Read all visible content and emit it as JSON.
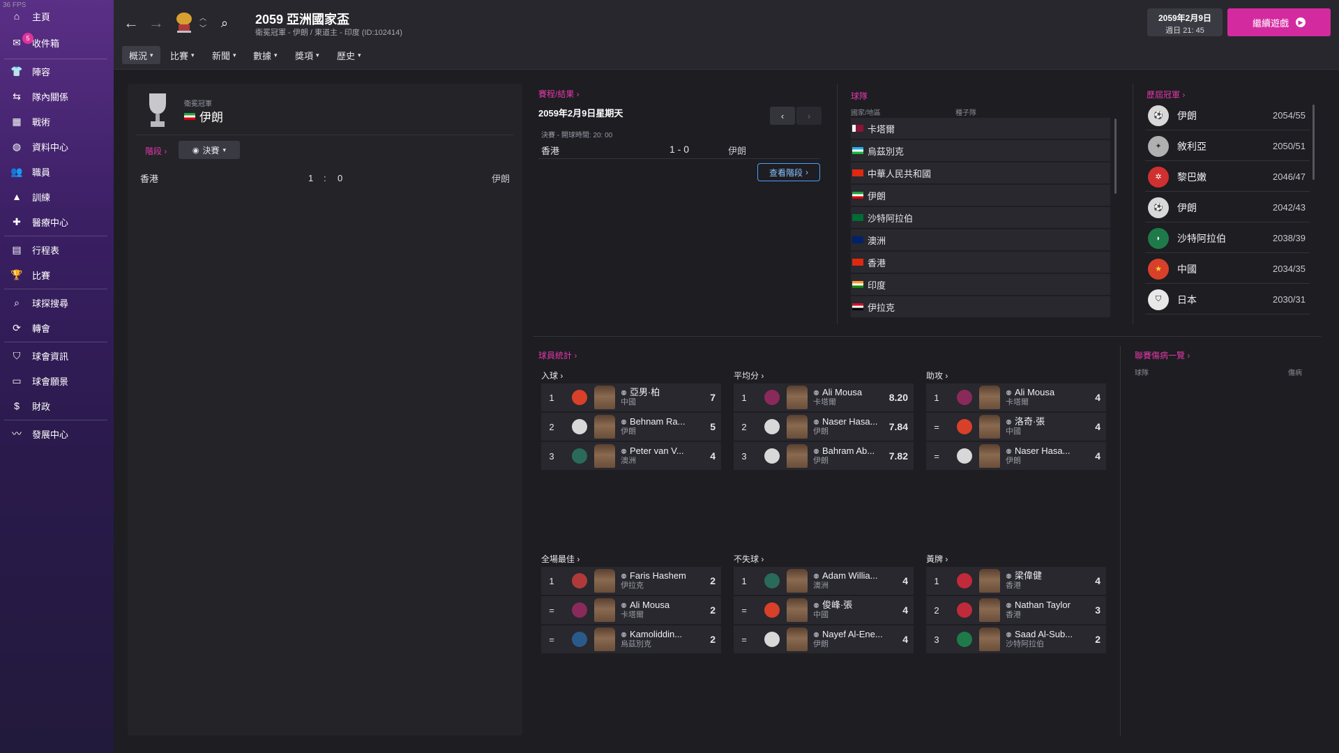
{
  "fps": "36 FPS",
  "sidebar": {
    "items": [
      {
        "label": "主頁",
        "icon": "home-icon"
      },
      {
        "label": "收件箱",
        "icon": "inbox-icon",
        "badge": "5"
      },
      {
        "label": "陣容",
        "icon": "squad-shirt-icon"
      },
      {
        "label": "隊內關係",
        "icon": "dynamics-icon"
      },
      {
        "label": "戰術",
        "icon": "tactics-icon"
      },
      {
        "label": "資料中心",
        "icon": "data-hub-icon"
      },
      {
        "label": "職員",
        "icon": "staff-icon"
      },
      {
        "label": "訓練",
        "icon": "training-icon"
      },
      {
        "label": "醫療中心",
        "icon": "medical-icon"
      },
      {
        "label": "行程表",
        "icon": "calendar-icon"
      },
      {
        "label": "比賽",
        "icon": "trophy-icon"
      },
      {
        "label": "球探搜尋",
        "icon": "search-icon"
      },
      {
        "label": "轉會",
        "icon": "transfer-icon"
      },
      {
        "label": "球會資訊",
        "icon": "club-info-icon"
      },
      {
        "label": "球會願景",
        "icon": "club-vision-icon"
      },
      {
        "label": "財政",
        "icon": "finances-icon"
      },
      {
        "label": "發展中心",
        "icon": "development-icon"
      }
    ]
  },
  "header": {
    "title": "2059 亞洲國家盃",
    "subtitle": "衛冕冠軍 - 伊朗 / 東道主 - 印度 (ID:102414)",
    "date_line1": "2059年2月9日",
    "date_line2": "週日 21: 45",
    "continue_label": "繼續遊戲"
  },
  "menu": [
    "概況",
    "比賽",
    "新聞",
    "數據",
    "獎項",
    "歷史"
  ],
  "left_panel": {
    "defending_label": "衛冕冠軍",
    "defending_team": "伊朗",
    "stage_link": "階段",
    "stage_select": "決賽",
    "match": {
      "home": "香港",
      "home_score": "1",
      "sep": ":",
      "away_score": "0",
      "away": "伊朗"
    }
  },
  "fixtures": {
    "link": "賽程/結果",
    "date": "2059年2月9日星期天",
    "info": "決賽 - 開球時間: 20: 00",
    "home": "香港",
    "score": "1 - 0",
    "away": "伊朗",
    "view_stage": "查看階段"
  },
  "teams": {
    "link": "球隊",
    "col1": "國家/地區",
    "col2": "種子隊",
    "list": [
      {
        "name": "卡塔爾",
        "flag": "qatar-flag"
      },
      {
        "name": "烏茲別克",
        "flag": "uzbekistan-flag"
      },
      {
        "name": "中華人民共和國",
        "flag": "china-flag"
      },
      {
        "name": "伊朗",
        "flag": "iran-flag"
      },
      {
        "name": "沙特阿拉伯",
        "flag": "saudi-flag"
      },
      {
        "name": "澳洲",
        "flag": "australia-flag"
      },
      {
        "name": "香港",
        "flag": "hongkong-flag"
      },
      {
        "name": "印度",
        "flag": "india-flag"
      },
      {
        "name": "伊拉克",
        "flag": "iraq-flag"
      }
    ]
  },
  "champions": {
    "link": "歷屆冠軍",
    "list": [
      {
        "team": "伊朗",
        "season": "2054/55",
        "color": "#d8d8d8"
      },
      {
        "team": "敘利亞",
        "season": "2050/51",
        "color": "#b0b0b0"
      },
      {
        "team": "黎巴嫩",
        "season": "2046/47",
        "color": "#d03030"
      },
      {
        "team": "伊朗",
        "season": "2042/43",
        "color": "#d8d8d8"
      },
      {
        "team": "沙特阿拉伯",
        "season": "2038/39",
        "color": "#1f7a4a"
      },
      {
        "team": "中國",
        "season": "2034/35",
        "color": "#d8402a"
      },
      {
        "team": "日本",
        "season": "2030/31",
        "color": "#e8e8e8"
      }
    ]
  },
  "player_stats": {
    "link": "球員統計",
    "groups": [
      {
        "title": "入球",
        "rows": [
          {
            "rank": "1",
            "name": "亞男·柏",
            "nation": "中國",
            "value": "7",
            "club": "#d8402a"
          },
          {
            "rank": "2",
            "name": "Behnam Ra...",
            "nation": "伊朗",
            "value": "5",
            "club": "#d8d8d8"
          },
          {
            "rank": "3",
            "name": "Peter van V...",
            "nation": "澳洲",
            "value": "4",
            "club": "#2a6a5a"
          }
        ]
      },
      {
        "title": "平均分",
        "rows": [
          {
            "rank": "1",
            "name": "Ali Mousa",
            "nation": "卡塔爾",
            "value": "8.20",
            "club": "#8a2a5a"
          },
          {
            "rank": "2",
            "name": "Naser Hasa...",
            "nation": "伊朗",
            "value": "7.84",
            "club": "#d8d8d8"
          },
          {
            "rank": "3",
            "name": "Bahram Ab...",
            "nation": "伊朗",
            "value": "7.82",
            "club": "#d8d8d8"
          }
        ]
      },
      {
        "title": "助攻",
        "rows": [
          {
            "rank": "1",
            "name": "Ali Mousa",
            "nation": "卡塔爾",
            "value": "4",
            "club": "#8a2a5a"
          },
          {
            "rank": "=",
            "name": "洛奇·張",
            "nation": "中國",
            "value": "4",
            "club": "#d8402a"
          },
          {
            "rank": "=",
            "name": "Naser Hasa...",
            "nation": "伊朗",
            "value": "4",
            "club": "#d8d8d8"
          }
        ]
      },
      {
        "title": "全場最佳",
        "rows": [
          {
            "rank": "1",
            "name": "Faris Hashem",
            "nation": "伊拉克",
            "value": "2",
            "club": "#b03a3a"
          },
          {
            "rank": "=",
            "name": "Ali Mousa",
            "nation": "卡塔爾",
            "value": "2",
            "club": "#8a2a5a"
          },
          {
            "rank": "=",
            "name": "Kamoliddin...",
            "nation": "烏茲別克",
            "value": "2",
            "club": "#2a5a8a"
          }
        ]
      },
      {
        "title": "不失球",
        "rows": [
          {
            "rank": "1",
            "name": "Adam Willia...",
            "nation": "澳洲",
            "value": "4",
            "club": "#2a6a5a"
          },
          {
            "rank": "=",
            "name": "俊峰·張",
            "nation": "中國",
            "value": "4",
            "club": "#d8402a"
          },
          {
            "rank": "=",
            "name": "Nayef Al-Ene...",
            "nation": "伊朗",
            "value": "4",
            "club": "#d8d8d8"
          }
        ]
      },
      {
        "title": "黃牌",
        "rows": [
          {
            "rank": "1",
            "name": "梁偉健",
            "nation": "香港",
            "value": "4",
            "club": "#c02a3a"
          },
          {
            "rank": "2",
            "name": "Nathan Taylor",
            "nation": "香港",
            "value": "3",
            "club": "#c02a3a"
          },
          {
            "rank": "3",
            "name": "Saad Al-Sub...",
            "nation": "沙特阿拉伯",
            "value": "2",
            "club": "#1f7a4a"
          }
        ]
      }
    ]
  },
  "injuries": {
    "link": "聯賽傷病一覽",
    "col1": "球隊",
    "col2": "傷病"
  }
}
